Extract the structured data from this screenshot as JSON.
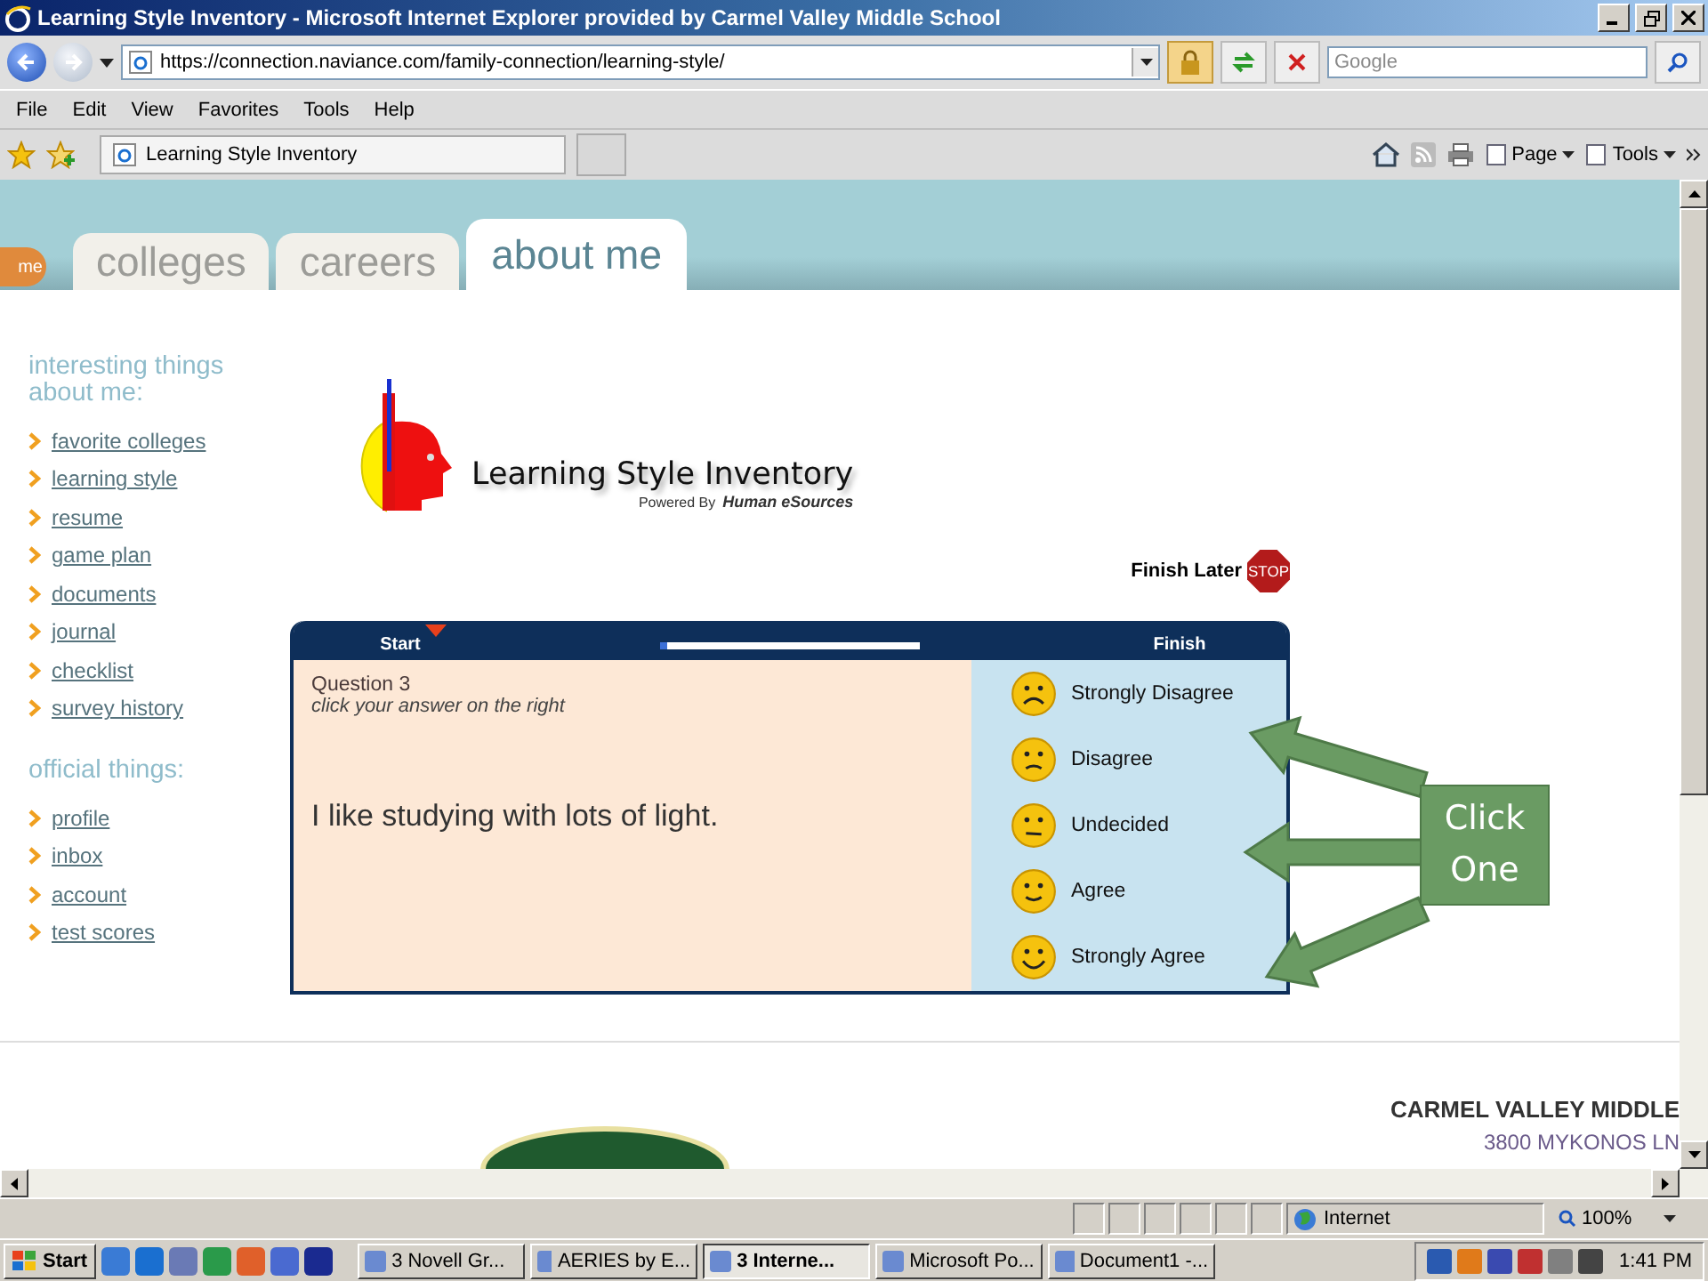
{
  "window": {
    "title": "Learning Style Inventory - Microsoft Internet Explorer provided by Carmel Valley Middle School"
  },
  "address_bar": {
    "url": "https://connection.naviance.com/family-connection/learning-style/"
  },
  "search": {
    "placeholder": "Google"
  },
  "menu": [
    "File",
    "Edit",
    "View",
    "Favorites",
    "Tools",
    "Help"
  ],
  "browser_tab": {
    "title": "Learning Style Inventory"
  },
  "command_bar": [
    "Page",
    "Tools"
  ],
  "site_nav": {
    "home_tab": "me",
    "tabs": [
      {
        "label": "colleges",
        "selected": false
      },
      {
        "label": "careers",
        "selected": false
      },
      {
        "label": "about me",
        "selected": true
      }
    ]
  },
  "sidebar": [
    {
      "heading": "interesting things about me:",
      "items": [
        "favorite colleges",
        "learning style",
        "resume",
        "game plan",
        "documents",
        "journal",
        "checklist",
        "survey history"
      ]
    },
    {
      "heading": "official things:",
      "items": [
        "profile",
        "inbox",
        "account",
        "test scores"
      ]
    }
  ],
  "logo": {
    "title": "Learning Style Inventory",
    "powered_by": "Powered By",
    "brand": "Human eSources"
  },
  "finish_later": {
    "label": "Finish Later",
    "sign": "STOP"
  },
  "progress": {
    "start": "Start",
    "finish": "Finish",
    "level": 0.03
  },
  "question": {
    "number": "Question 3",
    "hint": "click your answer on the right",
    "text": "I like studying with lots of light."
  },
  "answers": [
    {
      "label": "Strongly Disagree",
      "kind": "strongly_disagree"
    },
    {
      "label": "Disagree",
      "kind": "disagree"
    },
    {
      "label": "Undecided",
      "kind": "undecided"
    },
    {
      "label": "Agree",
      "kind": "agree"
    },
    {
      "label": "Strongly Agree",
      "kind": "strongly_agree"
    }
  ],
  "callout": {
    "text": "Click One"
  },
  "footer": {
    "school": "CARMEL VALLEY MIDDLE",
    "address": "3800 MYKONOS LN"
  },
  "status_bar": {
    "zone": "Internet",
    "zoom": "100%"
  },
  "taskbar": {
    "start": "Start",
    "tasks": [
      {
        "label": "3 Novell Gr...",
        "selected": false
      },
      {
        "label": "AERIES by E...",
        "selected": false
      },
      {
        "label": "3 Interne...",
        "selected": true
      },
      {
        "label": "Microsoft Po...",
        "selected": false
      },
      {
        "label": "Document1 -...",
        "selected": false
      }
    ],
    "clock": "1:41 PM"
  }
}
